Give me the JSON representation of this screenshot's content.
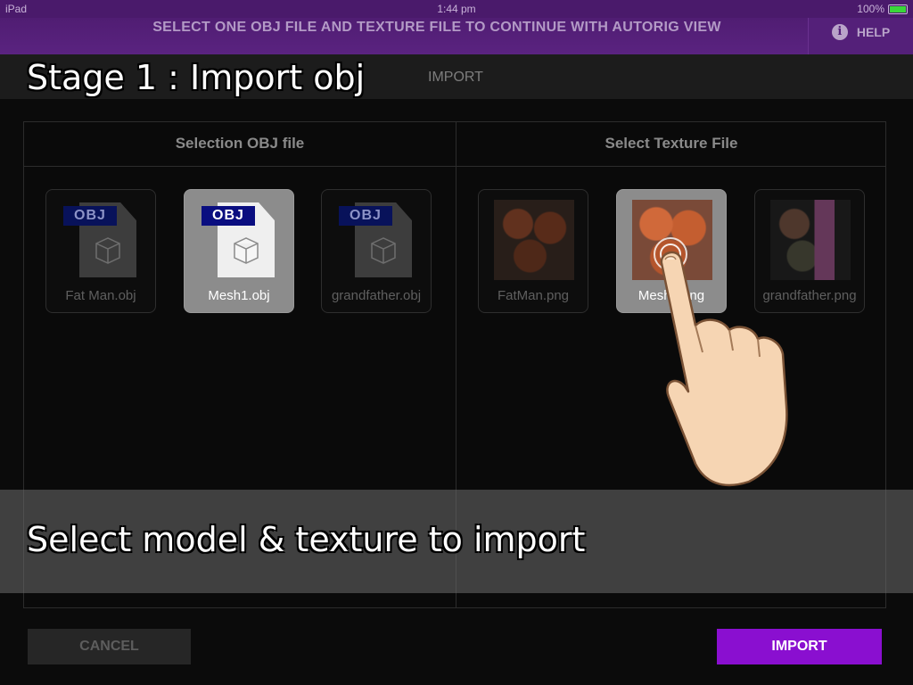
{
  "status_bar": {
    "device": "iPad",
    "time": "1:44 pm",
    "battery": "100%"
  },
  "header": {
    "message": "SELECT ONE OBJ FILE AND TEXTURE FILE TO CONTINUE WITH AUTORIG VIEW",
    "help_label": "HELP"
  },
  "stage": {
    "title": "Stage 1 : Import obj",
    "view_tab": "IMPORT"
  },
  "obj_column": {
    "title": "Selection OBJ file",
    "files": [
      {
        "name": "Fat Man.obj",
        "badge": "OBJ",
        "selected": false
      },
      {
        "name": "Mesh1.obj",
        "badge": "OBJ",
        "selected": true
      },
      {
        "name": "grandfather.obj",
        "badge": "OBJ",
        "selected": false
      }
    ]
  },
  "texture_column": {
    "title": "Select Texture File",
    "files": [
      {
        "name": "FatMan.png",
        "selected": false
      },
      {
        "name": "Mesh1.png",
        "selected": true
      },
      {
        "name": "grandfather.png",
        "selected": false
      }
    ]
  },
  "tip": {
    "text": "Select model & texture to import"
  },
  "buttons": {
    "cancel": "CANCEL",
    "import": "IMPORT"
  },
  "colors": {
    "header": "#4b1a6c",
    "import_button": "#8a0fd0",
    "selected_tile": "#8c8c8c"
  },
  "icons": [
    "info-icon",
    "battery-icon",
    "wifi-icon",
    "obj-file-icon",
    "cube-icon",
    "hand-pointer-icon"
  ]
}
